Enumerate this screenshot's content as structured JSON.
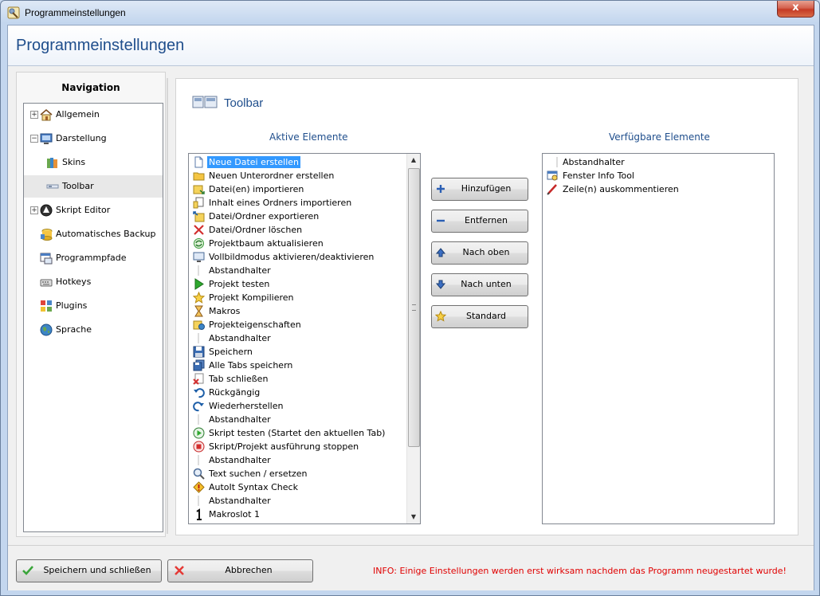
{
  "window": {
    "title": "Programmeinstellungen",
    "close_symbol": "x"
  },
  "header": {
    "title": "Programmeinstellungen"
  },
  "navigation": {
    "title": "Navigation",
    "items": [
      {
        "label": "Allgemein",
        "icon": "home-icon",
        "toggle": "+"
      },
      {
        "label": "Darstellung",
        "icon": "monitor-icon",
        "toggle": "−"
      },
      {
        "label": "Skins",
        "icon": "books-icon"
      },
      {
        "label": "Toolbar",
        "icon": "toolbar-icon"
      },
      {
        "label": "Skript Editor",
        "icon": "editor-icon",
        "toggle": "+"
      },
      {
        "label": "Automatisches Backup",
        "icon": "backup-icon"
      },
      {
        "label": "Programmpfade",
        "icon": "paths-icon"
      },
      {
        "label": "Hotkeys",
        "icon": "keyboard-icon"
      },
      {
        "label": "Plugins",
        "icon": "plugins-icon"
      },
      {
        "label": "Sprache",
        "icon": "globe-icon"
      }
    ]
  },
  "main": {
    "section_title": "Toolbar",
    "active_title": "Aktive Elemente",
    "available_title": "Verfügbare Elemente",
    "active_items": [
      {
        "label": "Neue Datei erstellen",
        "icon": "new-file-icon",
        "selected": true
      },
      {
        "label": "Neuen Unterordner erstellen",
        "icon": "folder-icon"
      },
      {
        "label": "Datei(en) importieren",
        "icon": "import-file-icon"
      },
      {
        "label": "Inhalt eines Ordners importieren",
        "icon": "import-folder-icon"
      },
      {
        "label": "Datei/Ordner exportieren",
        "icon": "export-icon"
      },
      {
        "label": "Datei/Ordner löschen",
        "icon": "delete-icon"
      },
      {
        "label": "Projektbaum aktualisieren",
        "icon": "refresh-icon"
      },
      {
        "label": "Vollbildmodus aktivieren/deaktivieren",
        "icon": "fullscreen-icon"
      },
      {
        "label": "Abstandhalter",
        "icon": "spacer-icon"
      },
      {
        "label": "Projekt testen",
        "icon": "play-icon"
      },
      {
        "label": "Projekt Kompilieren",
        "icon": "star-icon"
      },
      {
        "label": "Makros",
        "icon": "hourglass-icon"
      },
      {
        "label": "Projekteigenschaften",
        "icon": "properties-icon"
      },
      {
        "label": "Abstandhalter",
        "icon": "spacer-icon"
      },
      {
        "label": "Speichern",
        "icon": "save-icon"
      },
      {
        "label": "Alle Tabs speichern",
        "icon": "save-all-icon"
      },
      {
        "label": "Tab schließen",
        "icon": "close-tab-icon"
      },
      {
        "label": "Rückgängig",
        "icon": "undo-icon"
      },
      {
        "label": "Wiederherstellen",
        "icon": "redo-icon"
      },
      {
        "label": "Abstandhalter",
        "icon": "spacer-icon"
      },
      {
        "label": "Skript testen (Startet den aktuellen Tab)",
        "icon": "run-script-icon"
      },
      {
        "label": "Skript/Projekt ausführung stoppen",
        "icon": "stop-icon"
      },
      {
        "label": "Abstandhalter",
        "icon": "spacer-icon"
      },
      {
        "label": "Text suchen / ersetzen",
        "icon": "search-icon"
      },
      {
        "label": "AutoIt Syntax Check",
        "icon": "syntax-check-icon"
      },
      {
        "label": "Abstandhalter",
        "icon": "spacer-icon"
      },
      {
        "label": "Makroslot 1",
        "icon": "macro-slot-1-icon"
      }
    ],
    "available_items": [
      {
        "label": "Abstandhalter",
        "icon": "spacer-icon"
      },
      {
        "label": "Fenster Info Tool",
        "icon": "window-info-icon"
      },
      {
        "label": "Zeile(n) auskommentieren",
        "icon": "comment-icon"
      }
    ],
    "buttons": {
      "add": "Hinzufügen",
      "remove": "Entfernen",
      "up": "Nach oben",
      "down": "Nach unten",
      "default": "Standard"
    }
  },
  "footer": {
    "save_label": "Speichern und schließen",
    "cancel_label": "Abbrechen",
    "info": "INFO: Einige Einstellungen werden erst wirksam nachdem das Programm neugestartet wurde!"
  },
  "colors": {
    "accent": "#1f4e8c",
    "selection": "#3399ff",
    "info": "#e00000"
  }
}
